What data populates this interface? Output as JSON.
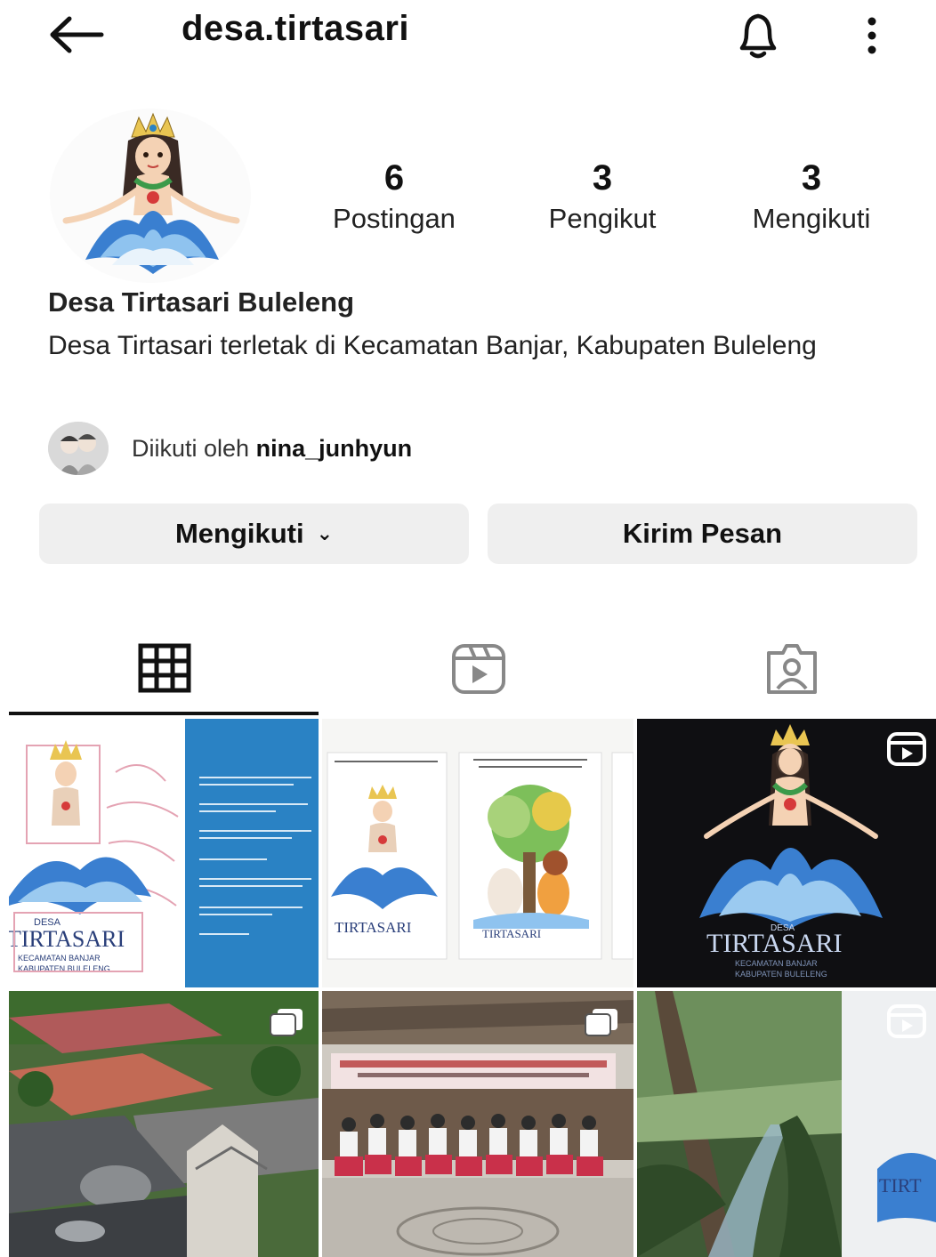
{
  "header": {
    "username": "desa.tirtasari",
    "back_icon": "arrow-left-icon",
    "bell_icon": "bell-icon",
    "more_icon": "more-vertical-icon"
  },
  "profile": {
    "avatar": "avatar",
    "stats": [
      {
        "value": "6",
        "label": "Postingan"
      },
      {
        "value": "3",
        "label": "Pengikut"
      },
      {
        "value": "3",
        "label": "Mengikuti"
      }
    ],
    "name": "Desa Tirtasari Buleleng",
    "bio": "Desa Tirtasari terletak di Kecamatan Banjar, Kabupaten Buleleng",
    "followed_by_prefix": "Diikuti oleh",
    "followed_by_user": "nina_junhyun"
  },
  "actions": {
    "follow_label": "Mengikuti",
    "message_label": "Kirim Pesan"
  },
  "tabs": [
    {
      "icon": "grid-icon",
      "active": true
    },
    {
      "icon": "reels-icon",
      "active": false
    },
    {
      "icon": "tagged-icon",
      "active": false
    }
  ],
  "posts": {
    "p1": {
      "title": "DESA",
      "name": "TIRTASARI",
      "sub1": "KECAMATAN BANJAR",
      "sub2": "KABUPATEN BULELENG"
    },
    "p2": {
      "name": "TIRTASARI"
    },
    "p3": {
      "title": "DESA",
      "name": "TIRTASARI",
      "sub1": "KECAMATAN BANJAR",
      "sub2": "KABUPATEN BULELENG"
    },
    "p6": {
      "name": "TIRT"
    }
  },
  "colors": {
    "accent_blue": "#2a82c4",
    "button_bg": "#efefef",
    "text": "#111111"
  }
}
